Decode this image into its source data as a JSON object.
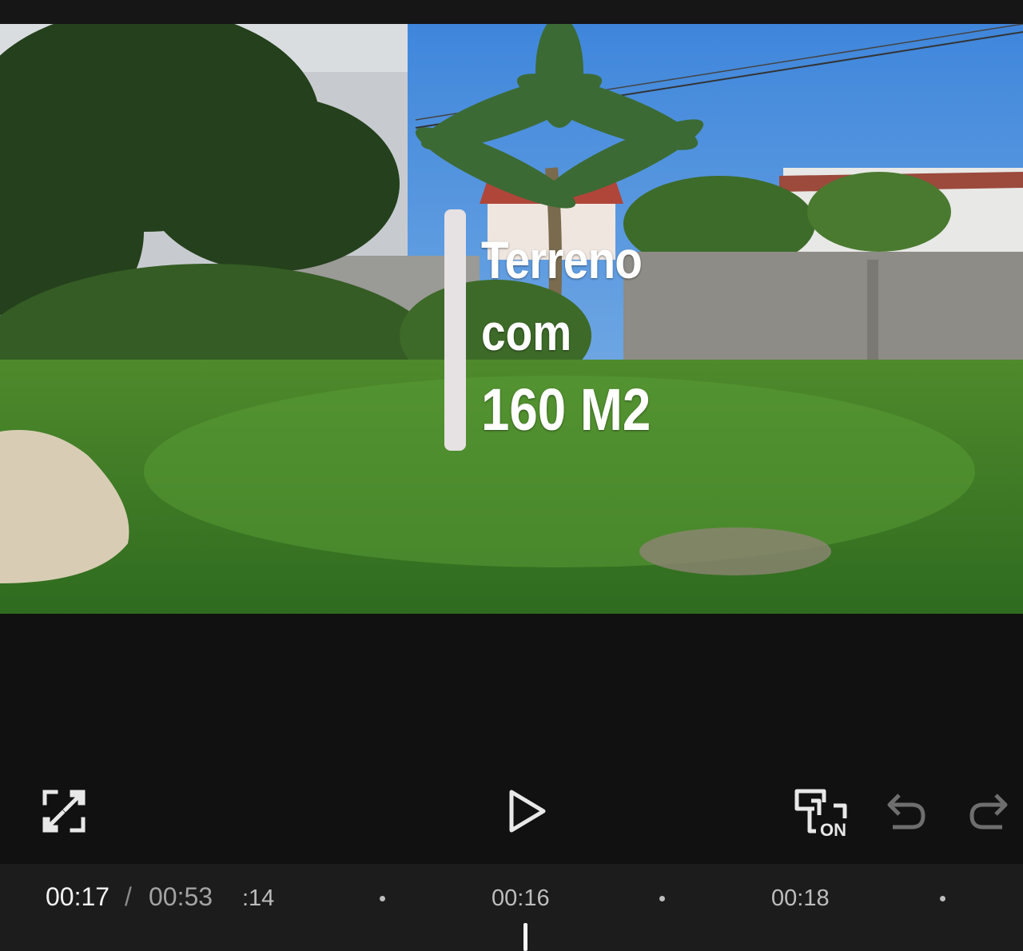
{
  "preview": {
    "caption_lines": [
      "Terreno",
      "com",
      "160 M2"
    ]
  },
  "toolbar": {
    "fullscreen_icon": "fullscreen-expand-icon",
    "play_icon": "play-icon",
    "keyframe_icon": "keyframe-toggle-icon",
    "keyframe_state": "ON",
    "undo_icon": "undo-icon",
    "redo_icon": "redo-icon"
  },
  "timeline": {
    "current_time": "00:17",
    "separator": "/",
    "total_time": "00:53",
    "ruler_labels": [
      ":14",
      "00:16",
      "00:18"
    ]
  },
  "colors": {
    "background": "#111111",
    "timeline_background": "#1c1c1c",
    "caption_bar": "#e6e1e3",
    "icon": "#e8e8e8"
  }
}
